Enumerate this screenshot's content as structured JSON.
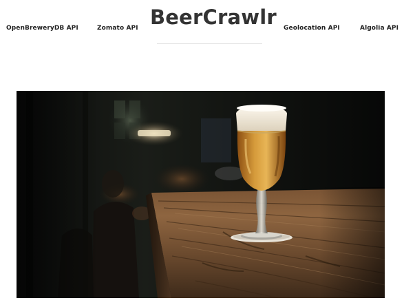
{
  "site": {
    "brand": "BeerCrawlr"
  },
  "nav": {
    "left": [
      {
        "label": "OpenBreweryDB API"
      },
      {
        "label": "Zomato API"
      }
    ],
    "right": [
      {
        "label": "Geolocation API"
      },
      {
        "label": "Algolia API"
      }
    ]
  },
  "hero": {
    "image": "beer-glass-on-wooden-bar-photo"
  }
}
